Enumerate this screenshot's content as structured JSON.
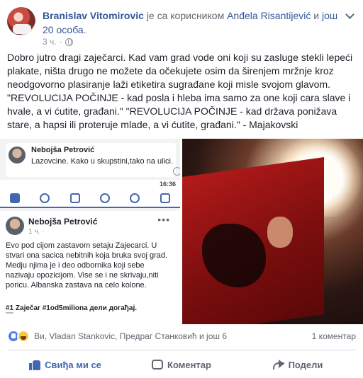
{
  "post": {
    "author": "Branislav Vitomirovic",
    "with_text": "је са корисником",
    "tagged": "Anđela Risantijević",
    "and_text": "и",
    "others": "још 20 особа",
    "time": "3 ч.",
    "period": ".",
    "text": "Dobro jutro dragi zaječarci. Kad vam grad vode oni koji su zasluge stekli lepeći plakate, ništa drugo ne možete da očekujete osim da širenjem mržnje kroz neodgovorno plasiranje laži etiketira sugrađane koji misle svojom glavom. \"REVOLUCIJA POČINJE - kad posla i hleba ima samo za one koji cara slave i hvale, a vi ćutite, građani.\" \"REVOLUCIJA POČINJE - kad država ponižava stare, a hapsi ili proteruje mlade, a vi ćutite, građani.\" - Majakovski"
  },
  "screenshot": {
    "comment": {
      "name": "Nebojša Petrović",
      "text": "Lazovcine. Kako u skupstini,tako na ulici."
    },
    "status_time": "16:36",
    "inner_post": {
      "name": "Nebojša Petrović",
      "meta": "1 ч. ·",
      "text": "Evo pod cijom zastavom setaju Zajecarci. U stvari ona sacica nebitnih koja bruka svoj grad. Medju njima je i deo odbornika koji sebe nazivaju opozicijom. Vise se i ne skrivaju,niti poricu. Albanska zastava na celo kolone.",
      "tags_prefix": "#1",
      "tags_main": "Zaječar",
      "tags_rest": "#1od5miliona дели догађај."
    }
  },
  "reactions": {
    "names": "Ви, Vladan Stankovic, Предраг Станковић и још 6",
    "comments_count": "1 коментар"
  },
  "actions": {
    "like": "Свиђа ми се",
    "comment": "Коментар",
    "share": "Подели"
  },
  "colors": {
    "link": "#365899",
    "like_blue": "#4267b2"
  }
}
